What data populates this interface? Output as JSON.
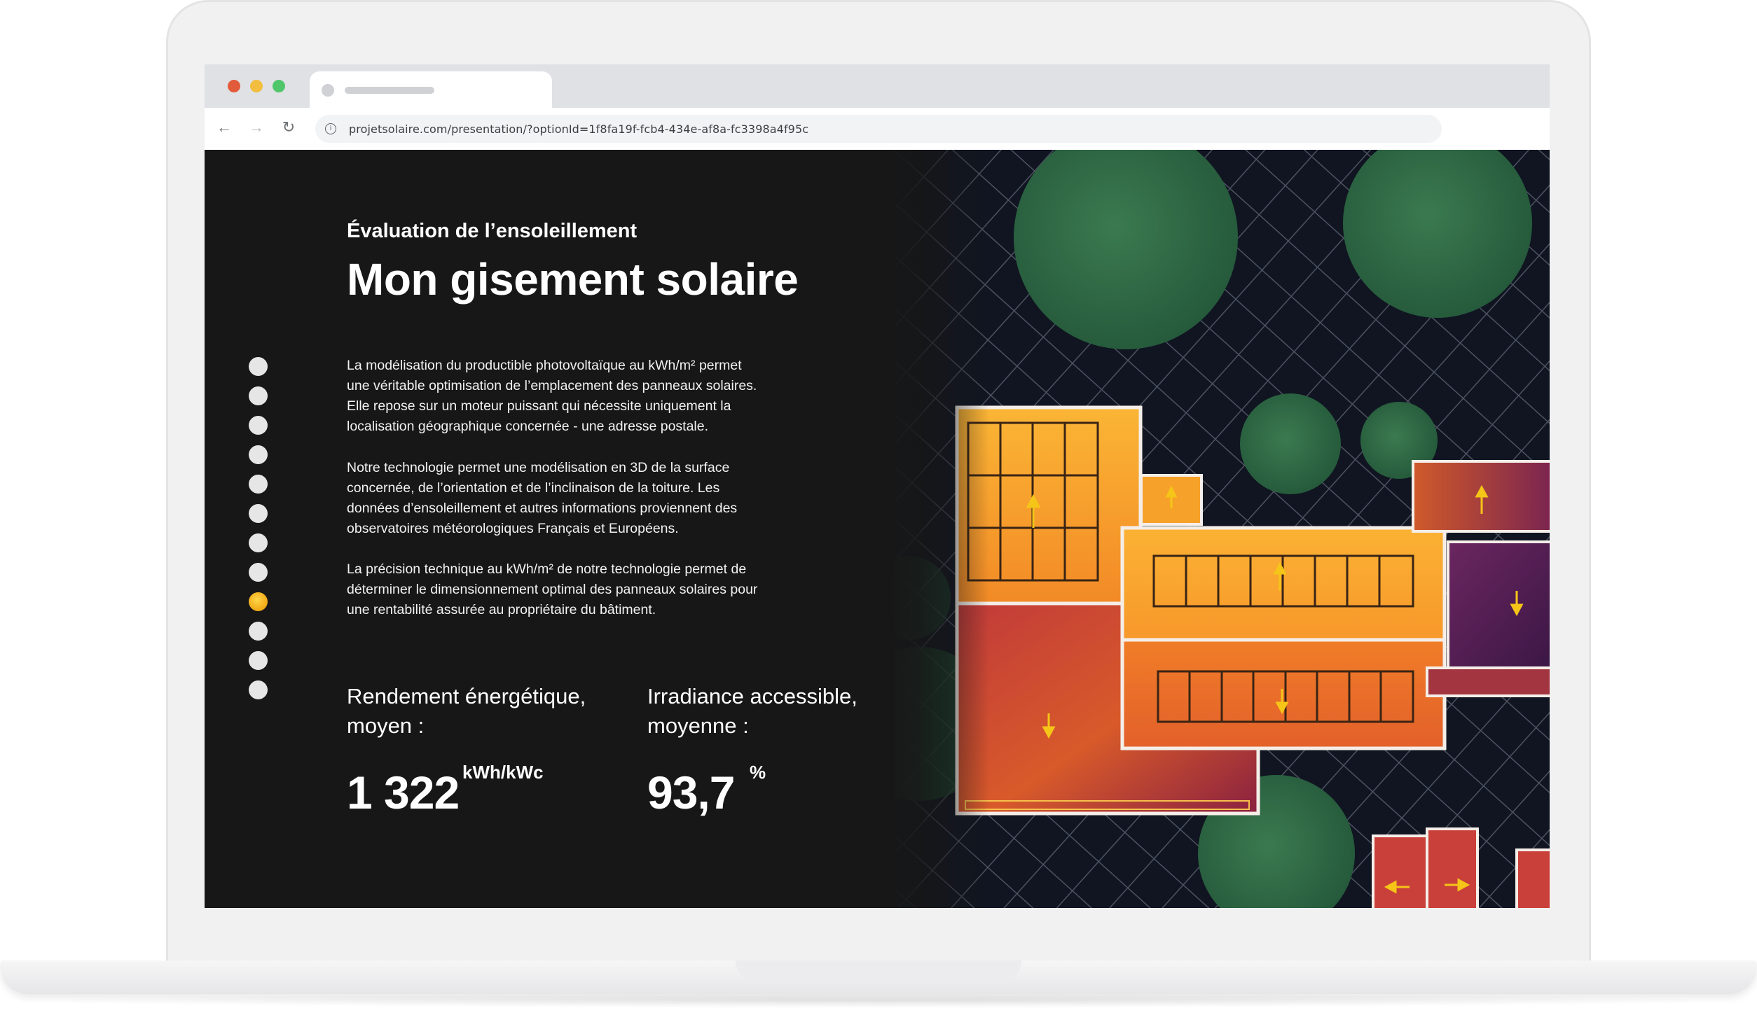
{
  "browser": {
    "url": "projetsolaire.com/presentation/?optionId=1f8fa19f-fcb4-434e-af8a-fc3398a4f95c"
  },
  "page": {
    "subtitle": "Évaluation de l’ensoleillement",
    "title": "Mon gisement solaire",
    "paragraphs": [
      [
        "La modélisation du productible photovoltaïque au kWh/m² permet",
        "une véritable optimisation de l’emplacement des panneaux solaires.",
        "Elle repose sur un moteur puissant qui nécessite uniquement la",
        "localisation géographique concernée - une adresse postale."
      ],
      [
        "Notre technologie permet une modélisation en 3D de la surface",
        "concernée, de l’orientation et de l’inclinaison de la toiture. Les",
        "données d’ensoleillement et autres informations proviennent des",
        "observatoires météorologiques Français et Européens."
      ],
      [
        "La précision technique au kWh/m² de notre technologie permet de",
        "déterminer le dimensionnement optimal des panneaux solaires  pour",
        "une rentabilité assurée au propriétaire du bâtiment."
      ]
    ],
    "pager": {
      "count": 12,
      "active_index": 8
    },
    "metrics": [
      {
        "label_line1": "Rendement énergétique,",
        "label_line2": "moyen :",
        "value": "1 322",
        "unit": "kWh/kWc"
      },
      {
        "label_line1": "Irradiance accessible,",
        "label_line2": "moyenne :",
        "value": "93,7",
        "unit": "%"
      }
    ]
  },
  "colors": {
    "background": "#171717",
    "accent_active_dot": "#f5b623",
    "tree": "#2f6a44",
    "roof_hot": "#f7a72b",
    "roof_mid": "#d4502a",
    "roof_cold": "#4a1a4e"
  }
}
